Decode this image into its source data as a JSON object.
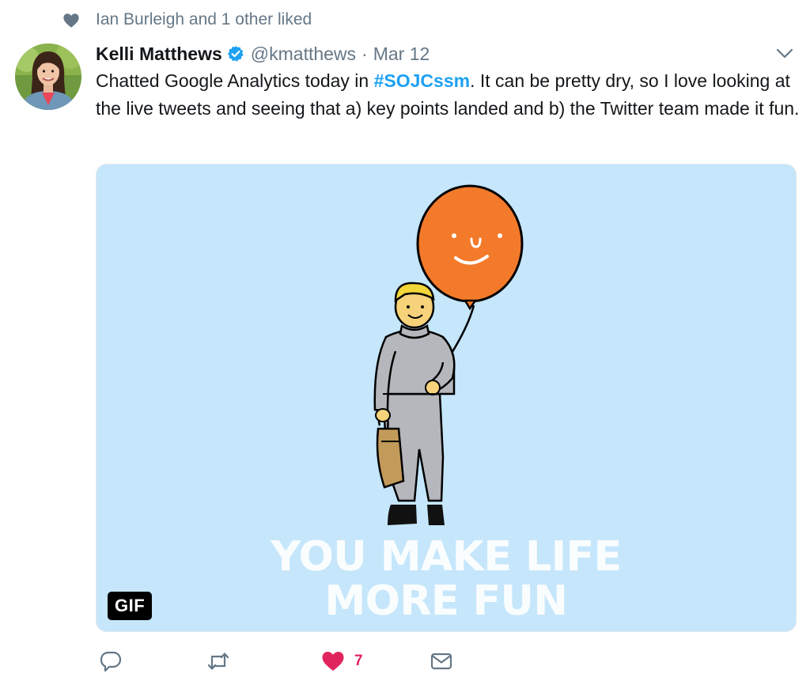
{
  "social_context": {
    "text": "Ian Burleigh and 1 other liked",
    "icon": "heart-icon"
  },
  "author": {
    "name": "Kelli Matthews",
    "handle": "@kmatthews",
    "separator": "·",
    "timestamp": "Mar 12",
    "verified": true
  },
  "tweet": {
    "text_before": "Chatted Google Analytics today in ",
    "hashtag": "#SOJCssm",
    "text_after": ". It can be pretty dry, so I love looking at the live tweets and seeing that a) key points landed and b) the Twitter team made it fun."
  },
  "media": {
    "badge": "GIF",
    "caption_line1": "YOU MAKE LIFE",
    "caption_line2": "MORE FUN",
    "background_color": "#c5e6fb",
    "balloon_color": "#f47a2b"
  },
  "actions": {
    "reply_icon": "reply-icon",
    "retweet_icon": "retweet-icon",
    "like_icon": "heart-icon",
    "like_count": "7",
    "like_color": "#e0245e",
    "dm_icon": "envelope-icon"
  },
  "colors": {
    "link": "#1da1f2",
    "secondary_text": "#657786"
  }
}
